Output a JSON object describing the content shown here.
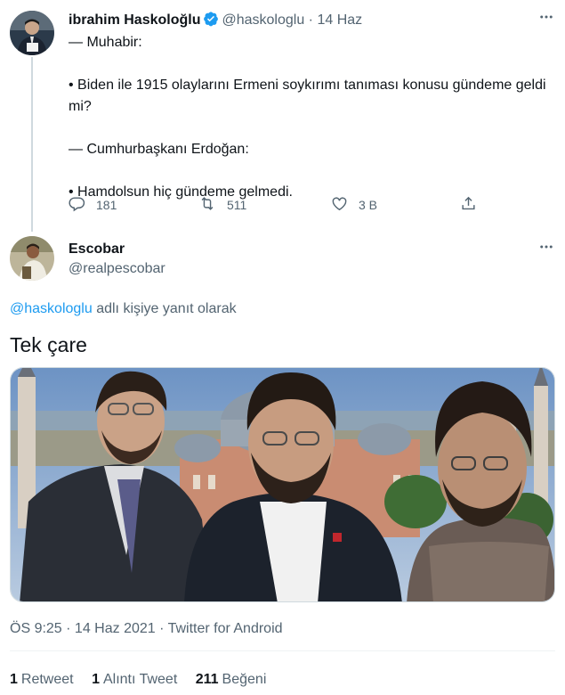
{
  "tweet1": {
    "display_name": "ibrahim Haskoloğlu",
    "handle": "@haskologlu",
    "separator": "·",
    "date": "14 Haz",
    "lines": [
      "— Muhabir:",
      "• Biden ile 1915 olaylarını Ermeni soykırımı tanıması konusu gündeme geldi mi?",
      "— Cumhurbaşkanı Erdoğan:",
      "• Hamdolsun hiç gündeme gelmedi."
    ],
    "replies": "181",
    "retweets": "511",
    "likes": "3 B"
  },
  "tweet2": {
    "display_name": "Escobar",
    "handle": "@realpescobar",
    "reply_to_mention": "@haskologlu",
    "reply_to_suffix": " adlı kişiye yanıt olarak",
    "text": "Tek çare",
    "timestamp": "ÖS 9:25 · 14 Haz 2021 · Twitter for Android",
    "stats": {
      "retweet_count": "1",
      "retweet_label": "Retweet",
      "quote_count": "1",
      "quote_label": "Alıntı Tweet",
      "like_count": "211",
      "like_label": "Beğeni"
    }
  },
  "icons": {
    "verified": "verified-badge-icon",
    "reply": "reply-icon",
    "retweet": "retweet-icon",
    "like": "heart-icon",
    "share": "share-icon",
    "more": "more-icon"
  },
  "colors": {
    "text": "#0f1419",
    "secondary": "#536471",
    "accent": "#1d9bf0",
    "border": "#cfd9de"
  }
}
